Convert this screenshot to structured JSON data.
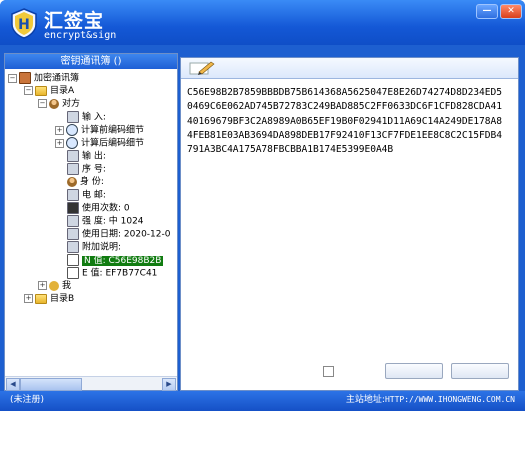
{
  "app": {
    "title": "汇签宝",
    "subtitle": "encrypt&sign",
    "window_buttons": [
      "—",
      "✕"
    ]
  },
  "left": {
    "header": "密钥通讯簿 ()",
    "tree": {
      "root": "加密通讯簿",
      "dirA": "目录A",
      "contact": "对方",
      "fields": {
        "input": "输      入:",
        "before_detail": "计算前编码细节",
        "after_detail": "计算后编码细节",
        "out": "输      出:",
        "serial": "序      号:",
        "id": "身      份:",
        "phone": "电      邮:",
        "use_count": "使用次数: 0",
        "strength": "强      度:  中   1024",
        "use_date": "使用日期: 2020-12-0",
        "note": "附加说明:",
        "n_value": "N     值:  C56E98B2B",
        "e_value": "E     值:  EF7B77C41"
      },
      "me": "我",
      "dirB": "目录B"
    }
  },
  "right": {
    "content": "C56E98B2B7859BBBDB75B614368A5625047E8E26D74274D8D234ED50469C6E062AD745B72783C249BAD885C2FF0633DC6F1CFD828CDA4140169679BF3C2A8989A0B65EF19B0F02941D11A69C14A249DE178A84FEB81E03AB3694DA898DEB17F92410F13CF7FDE1EE8C8C2C15FDB4791A3BC4A175A78FBCBBA1B174E5399E0A4B"
  },
  "status": {
    "left": "(未注册)",
    "right_label": "主站地址:",
    "right_url": "HTTP://WWW.IHONGWENG.COM.CN"
  }
}
